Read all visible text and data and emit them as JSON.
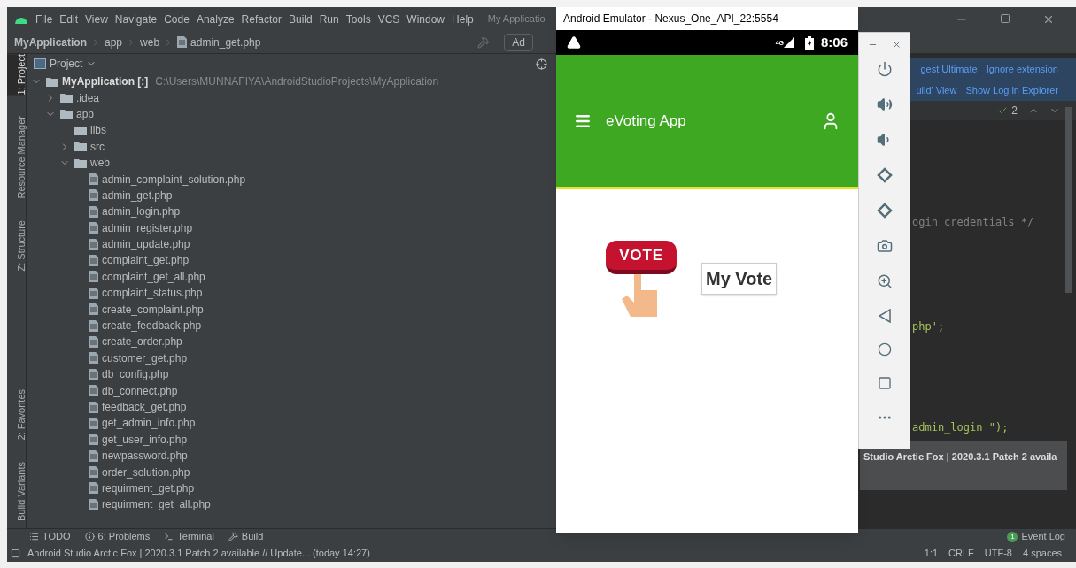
{
  "ide": {
    "menu": [
      "File",
      "Edit",
      "View",
      "Navigate",
      "Code",
      "Analyze",
      "Refactor",
      "Build",
      "Run",
      "Tools",
      "VCS",
      "Window",
      "Help"
    ],
    "window_title": "My Applicatio",
    "breadcrumb": [
      "MyApplication",
      "app",
      "web",
      "admin_get.php"
    ],
    "toolbar_button": "Ad",
    "side_tabs_top": [
      {
        "label": "1: Project",
        "selected": true
      },
      {
        "label": "Resource Manager",
        "selected": false
      },
      {
        "label": "Z: Structure",
        "selected": false
      }
    ],
    "side_tabs_bottom": [
      {
        "label": "2: Favorites",
        "selected": false
      },
      {
        "label": "Build Variants",
        "selected": false
      }
    ],
    "project_panel": {
      "title": "Project",
      "tree": [
        {
          "kind": "folder",
          "label": "MyApplication [:]",
          "path": "C:\\Users\\MUNNAFIYA\\AndroidStudioProjects\\MyApplication",
          "expanded": true,
          "children": [
            {
              "kind": "folder",
              "label": ".idea",
              "expanded": false
            },
            {
              "kind": "folder",
              "label": "app",
              "expanded": true,
              "children": [
                {
                  "kind": "folder",
                  "label": "libs"
                },
                {
                  "kind": "folder",
                  "label": "src",
                  "expanded": false
                },
                {
                  "kind": "folder",
                  "label": "web",
                  "expanded": true,
                  "children": [
                    {
                      "kind": "file",
                      "label": "admin_complaint_solution.php"
                    },
                    {
                      "kind": "file",
                      "label": "admin_get.php"
                    },
                    {
                      "kind": "file",
                      "label": "admin_login.php"
                    },
                    {
                      "kind": "file",
                      "label": "admin_register.php"
                    },
                    {
                      "kind": "file",
                      "label": "admin_update.php"
                    },
                    {
                      "kind": "file",
                      "label": "complaint_get.php"
                    },
                    {
                      "kind": "file",
                      "label": "complaint_get_all.php"
                    },
                    {
                      "kind": "file",
                      "label": "complaint_status.php"
                    },
                    {
                      "kind": "file",
                      "label": "create_complaint.php"
                    },
                    {
                      "kind": "file",
                      "label": "create_feedback.php"
                    },
                    {
                      "kind": "file",
                      "label": "create_order.php"
                    },
                    {
                      "kind": "file",
                      "label": "customer_get.php"
                    },
                    {
                      "kind": "file",
                      "label": "db_config.php"
                    },
                    {
                      "kind": "file",
                      "label": "db_connect.php"
                    },
                    {
                      "kind": "file",
                      "label": "feedback_get.php"
                    },
                    {
                      "kind": "file",
                      "label": "get_admin_info.php"
                    },
                    {
                      "kind": "file",
                      "label": "get_user_info.php"
                    },
                    {
                      "kind": "file",
                      "label": "newpassword.php"
                    },
                    {
                      "kind": "file",
                      "label": "order_solution.php"
                    },
                    {
                      "kind": "file",
                      "label": "requirment_get.php"
                    },
                    {
                      "kind": "file",
                      "label": "requirment_get_all.php"
                    }
                  ]
                }
              ]
            }
          ]
        }
      ]
    },
    "notification_links": [
      [
        "gest Ultimate",
        "Ignore extension"
      ],
      [
        "uild' View",
        "Show Log in Explorer"
      ]
    ],
    "problems_count": "2",
    "code_lines": [
      {
        "text": "ogin credentials */",
        "kind": "comment"
      },
      {
        "text": "php';",
        "kind": "string"
      },
      {
        "text": "admin_login  \");",
        "kind": "string"
      }
    ],
    "popup": "Studio Arctic Fox | 2020.3.1 Patch 2 availa",
    "tool_tabs": [
      "TODO",
      "6: Problems",
      "Terminal",
      "Build"
    ],
    "event_log": {
      "count": "1",
      "label": "Event Log"
    },
    "status": {
      "message": "Android Studio Arctic Fox | 2020.3.1 Patch 2 available // Update... (today 14:27)",
      "items": [
        "1:1",
        "CRLF",
        "UTF-8",
        "4 spaces"
      ]
    }
  },
  "emulator": {
    "title": "Android Emulator - Nexus_One_API_22:5554",
    "network": "4G",
    "time": "8:06",
    "app_title": "eVoting App",
    "vote_badge": "VOTE",
    "button": "My Vote"
  }
}
